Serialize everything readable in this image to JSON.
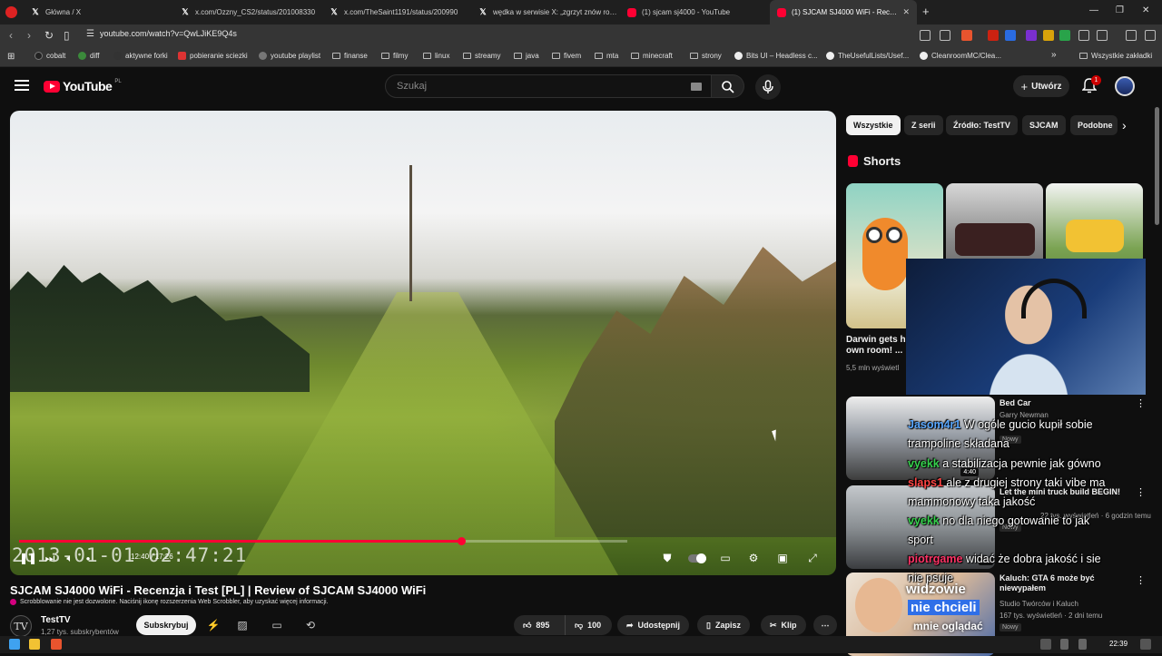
{
  "browser": {
    "tabs": [
      {
        "title": "Główna / X",
        "icon": "x-icon"
      },
      {
        "title": "x.com/Ozzny_CS2/status/201008330",
        "icon": "x-icon"
      },
      {
        "title": "x.com/TheSaint1191/status/200990",
        "icon": "x-icon"
      },
      {
        "title": "wędka w serwisie X: „zgrzyt znów ro…",
        "icon": "x-icon"
      },
      {
        "title": "(1) sjcam sj4000 - YouTube",
        "icon": "youtube-icon"
      },
      {
        "title": "(1) SJCAM SJ4000 WiFi - Rec…",
        "icon": "youtube-icon",
        "active": true
      }
    ],
    "new_tab": "+",
    "url": "youtube.com/watch?v=QwLJiKE9Q4s",
    "bookmarks": [
      {
        "label": "cobalt"
      },
      {
        "label": "diff"
      },
      {
        "label": "aktywne forki"
      },
      {
        "label": "pobieranie sciezki"
      },
      {
        "label": "youtube playlist"
      },
      {
        "label": "finanse"
      },
      {
        "label": "filmy"
      },
      {
        "label": "linux"
      },
      {
        "label": "streamy"
      },
      {
        "label": "java"
      },
      {
        "label": "fivem"
      },
      {
        "label": "mta"
      },
      {
        "label": "minecraft"
      },
      {
        "label": "strony"
      },
      {
        "label": "Bits UI – Headless c..."
      },
      {
        "label": "TheUsefulLists/Usef..."
      },
      {
        "label": "CleanroomMC/Clea..."
      }
    ],
    "bookmarks_more": "»",
    "all_bookmarks": "Wszystkie zakładki"
  },
  "youtube": {
    "logo_text": "YouTube",
    "logo_region": "PL",
    "search_placeholder": "Szukaj",
    "create_label": "Utwórz",
    "notification_count": "1"
  },
  "video": {
    "burned_timestamp": "2013-01-01 02:47:21",
    "time_display": "12:40 / 17:26",
    "progress_fraction": 0.727,
    "title": "SJCAM SJ4000 WiFi - Recenzja i Test [PL] | Review of SJCAM SJ4000 WiFi",
    "scrobble_notice": "Scrobblowanie nie jest dozwolone. Naciśnij ikonę rozszerzenia Web Scrobbler, aby uzyskać więcej informacji.",
    "channel": {
      "name": "TestTV",
      "subs": "1,27 tys. subskrybentów",
      "avatar_text": "TV"
    },
    "subscribe_label": "Subskrybuj",
    "likes": "895",
    "dislikes": "100",
    "share_label": "Udostępnij",
    "save_label": "Zapisz",
    "clip_label": "Klip",
    "more_label": "⋯"
  },
  "sidebar": {
    "chips": [
      {
        "label": "Wszystkie",
        "active": true
      },
      {
        "label": "Z serii"
      },
      {
        "label": "Źródło: TestTV"
      },
      {
        "label": "SJCAM"
      },
      {
        "label": "Podobne"
      }
    ],
    "shorts_heading": "Shorts",
    "shorts": [
      {
        "title": "Darwin gets h own room! ...",
        "views": "5,5 mln wyświetl"
      }
    ],
    "related": [
      {
        "title": "Bed Car",
        "channel": "Garry Newman",
        "meta": "",
        "badge": "Nowy",
        "duration": "4:40"
      },
      {
        "title": "Let the mini truck build BEGIN!",
        "channel": "",
        "meta": "22 tys. wyświetleń · 6 godzin temu",
        "badge": "Nowy",
        "duration": "30:"
      },
      {
        "title": "Kaluch: GTA 6 może być niewypałem",
        "channel": "Studio Twórców i Kaluch",
        "meta": "167 tys. wyświetleń · 2 dni temu",
        "badge": "Nowy",
        "duration": ""
      }
    ],
    "thumb3_text_top": "widzowie",
    "thumb3_text_mid": "nie chcieli",
    "thumb3_text_bot": "mnie oglądać"
  },
  "chat": [
    {
      "user": "Jasom4r1",
      "text": "W ogóle gucio kupił sobie",
      "color": "#5aa8ff"
    },
    {
      "user": "",
      "text": "trampoline składana",
      "color": "#ffffff"
    },
    {
      "user": "vyekk",
      "text": "a stabilizacja pewnie jak gówno",
      "color": "#36d14d"
    },
    {
      "user": "slaps1",
      "text": "ale z drugiej strony taki vibe ma",
      "color": "#ff4444"
    },
    {
      "user": "",
      "text": "mammonowy taka jakość",
      "color": "#ffffff"
    },
    {
      "user": "vyekk",
      "text": "no dla niego gotowanie to jak",
      "color": "#36d14d"
    },
    {
      "user": "",
      "text": "sport",
      "color": "#ffffff"
    },
    {
      "user": "piotrgame",
      "text": "widać że dobra jakość i sie",
      "color": "#ff3366"
    },
    {
      "user": "",
      "text": "nie psuje",
      "color": "#ffffff"
    }
  ],
  "taskbar": {
    "clock": "22:39"
  }
}
